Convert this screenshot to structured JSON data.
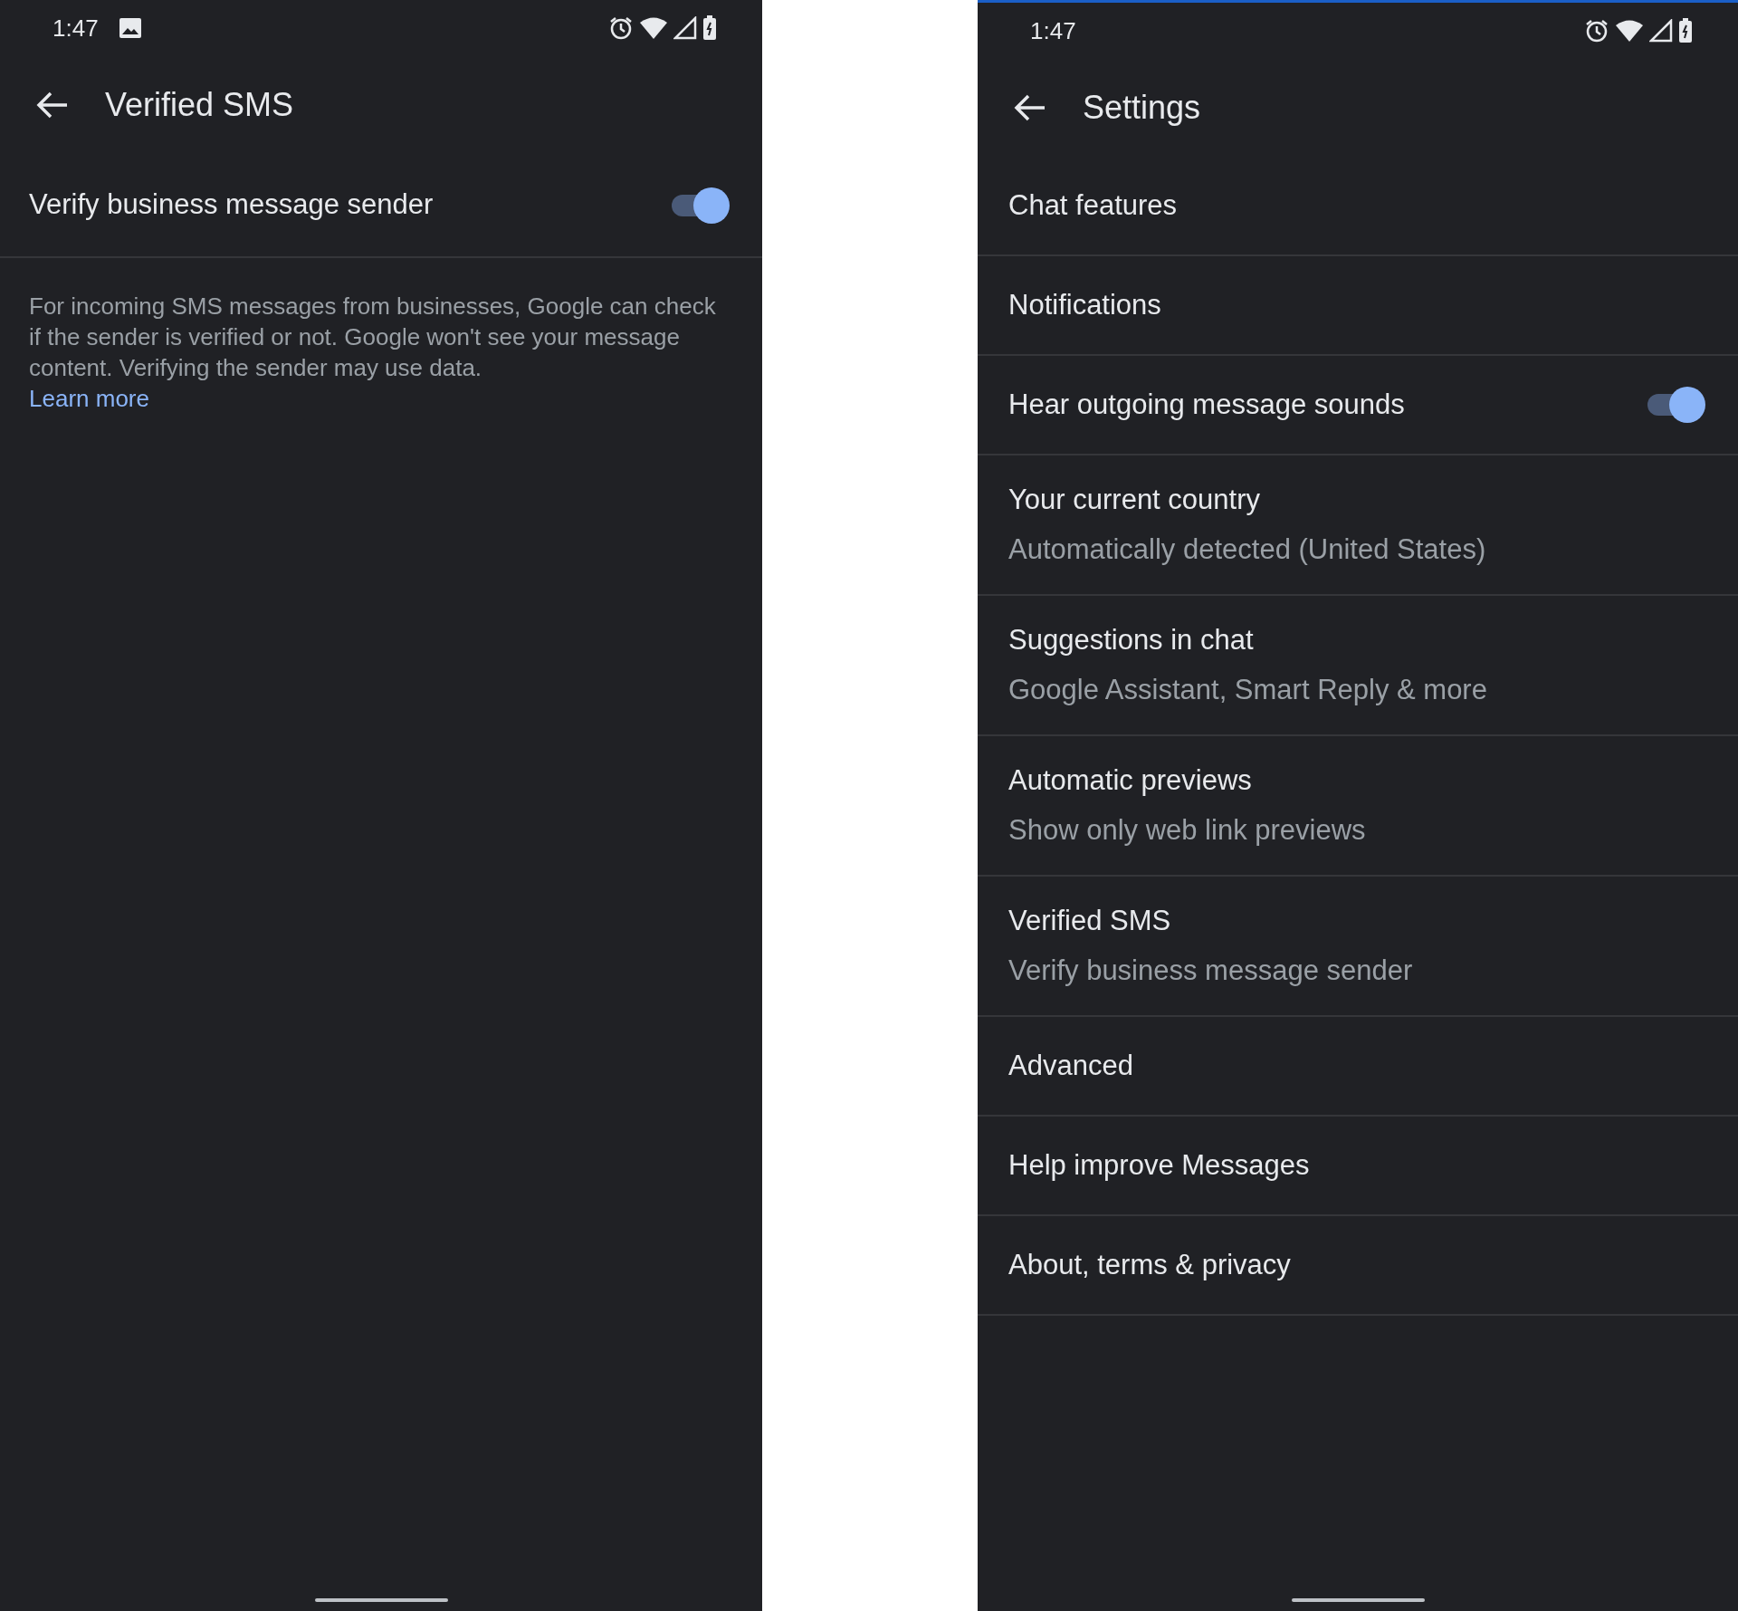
{
  "left_screen": {
    "status_bar": {
      "time": "1:47"
    },
    "title": "Verified SMS",
    "setting": {
      "label": "Verify business message sender",
      "on": true
    },
    "description": "For incoming SMS messages from businesses, Google can check if the sender is verified or not. Google won't see your message content. Verifying the sender may use data.",
    "link": "Learn more"
  },
  "right_screen": {
    "status_bar": {
      "time": "1:47"
    },
    "title": "Settings",
    "items": [
      {
        "kind": "plain",
        "title": "Chat features"
      },
      {
        "kind": "plain",
        "title": "Notifications"
      },
      {
        "kind": "toggle",
        "title": "Hear outgoing message sounds",
        "on": true
      },
      {
        "kind": "subtitle",
        "title": "Your current country",
        "subtitle": "Automatically detected (United States)"
      },
      {
        "kind": "subtitle",
        "title": "Suggestions in chat",
        "subtitle": "Google Assistant, Smart Reply & more"
      },
      {
        "kind": "subtitle",
        "title": "Automatic previews",
        "subtitle": "Show only web link previews"
      },
      {
        "kind": "subtitle",
        "title": "Verified SMS",
        "subtitle": "Verify business message sender"
      },
      {
        "kind": "plain",
        "title": "Advanced"
      },
      {
        "kind": "plain",
        "title": "Help improve Messages"
      },
      {
        "kind": "plain",
        "title": "About, terms & privacy"
      }
    ]
  }
}
